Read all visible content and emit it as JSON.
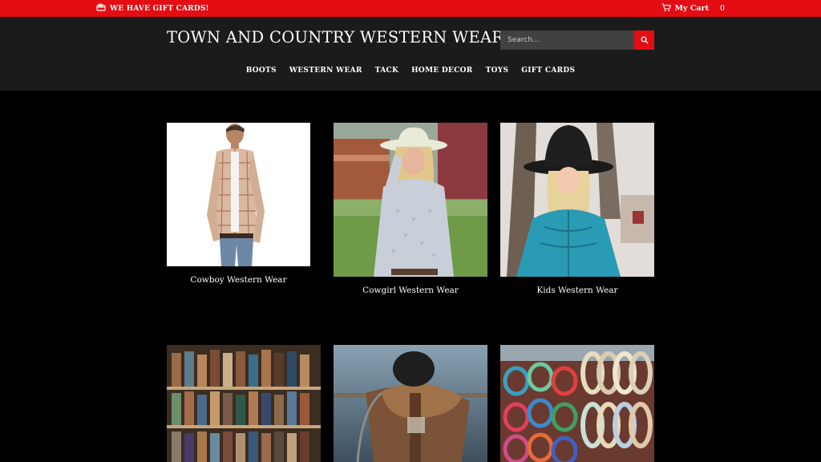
{
  "announcement": {
    "text": "WE HAVE GIFT CARDS!",
    "icon": "gift-card-icon"
  },
  "cart": {
    "label": "My Cart",
    "count": "0",
    "icon": "cart-icon"
  },
  "header": {
    "title": "TOWN AND COUNTRY WESTERN WEAR",
    "search_placeholder": "Search...",
    "search_icon": "search-icon"
  },
  "nav": {
    "items": [
      {
        "label": "BOOTS"
      },
      {
        "label": "WESTERN WEAR"
      },
      {
        "label": "TACK"
      },
      {
        "label": "HOME DECOR"
      },
      {
        "label": "TOYS"
      },
      {
        "label": "GIFT CARDS"
      }
    ]
  },
  "collections": [
    {
      "caption": "Cowboy Western Wear"
    },
    {
      "caption": "Cowgirl Western Wear"
    },
    {
      "caption": "Kids Western Wear"
    },
    {
      "caption": ""
    },
    {
      "caption": ""
    },
    {
      "caption": ""
    }
  ],
  "colors": {
    "accent": "#e30d13",
    "header_bg": "#1b1b1b",
    "page_bg": "#000000"
  }
}
